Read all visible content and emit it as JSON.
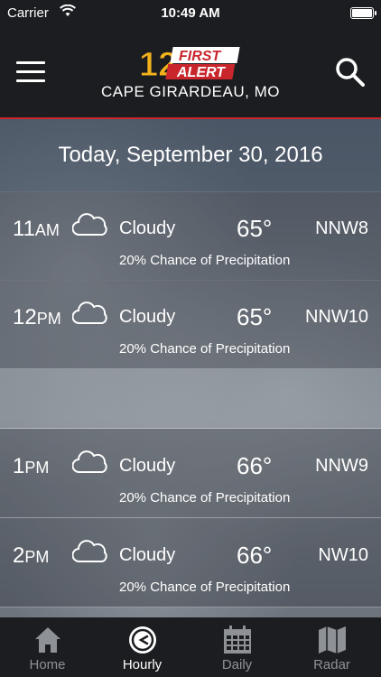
{
  "status_bar": {
    "carrier": "Carrier",
    "time": "10:49 AM"
  },
  "header": {
    "location": "CAPE GIRARDEAU, MO",
    "logo_number": "12",
    "logo_first": "FIRST",
    "logo_alert": "ALERT"
  },
  "date_label": "Today, September 30, 2016",
  "hours": [
    {
      "hour": "11",
      "ampm": "AM",
      "condition": "Cloudy",
      "temp": "65°",
      "wind": "NNW8",
      "precip": "20% Chance of Precipitation"
    },
    {
      "hour": "12",
      "ampm": "PM",
      "condition": "Cloudy",
      "temp": "65°",
      "wind": "NNW10",
      "precip": "20% Chance of Precipitation"
    },
    {
      "hour": "1",
      "ampm": "PM",
      "condition": "Cloudy",
      "temp": "66°",
      "wind": "NNW9",
      "precip": "20% Chance of Precipitation"
    },
    {
      "hour": "2",
      "ampm": "PM",
      "condition": "Cloudy",
      "temp": "66°",
      "wind": "NW10",
      "precip": "20% Chance of Precipitation"
    }
  ],
  "tabs": [
    {
      "label": "Home",
      "icon": "home-icon"
    },
    {
      "label": "Hourly",
      "icon": "clock-icon",
      "active": true
    },
    {
      "label": "Daily",
      "icon": "calendar-icon"
    },
    {
      "label": "Radar",
      "icon": "map-icon"
    }
  ],
  "colors": {
    "accent_red": "#c8262c",
    "header_bg": "#1c1d20",
    "logo_yellow": "#f2b21b"
  }
}
